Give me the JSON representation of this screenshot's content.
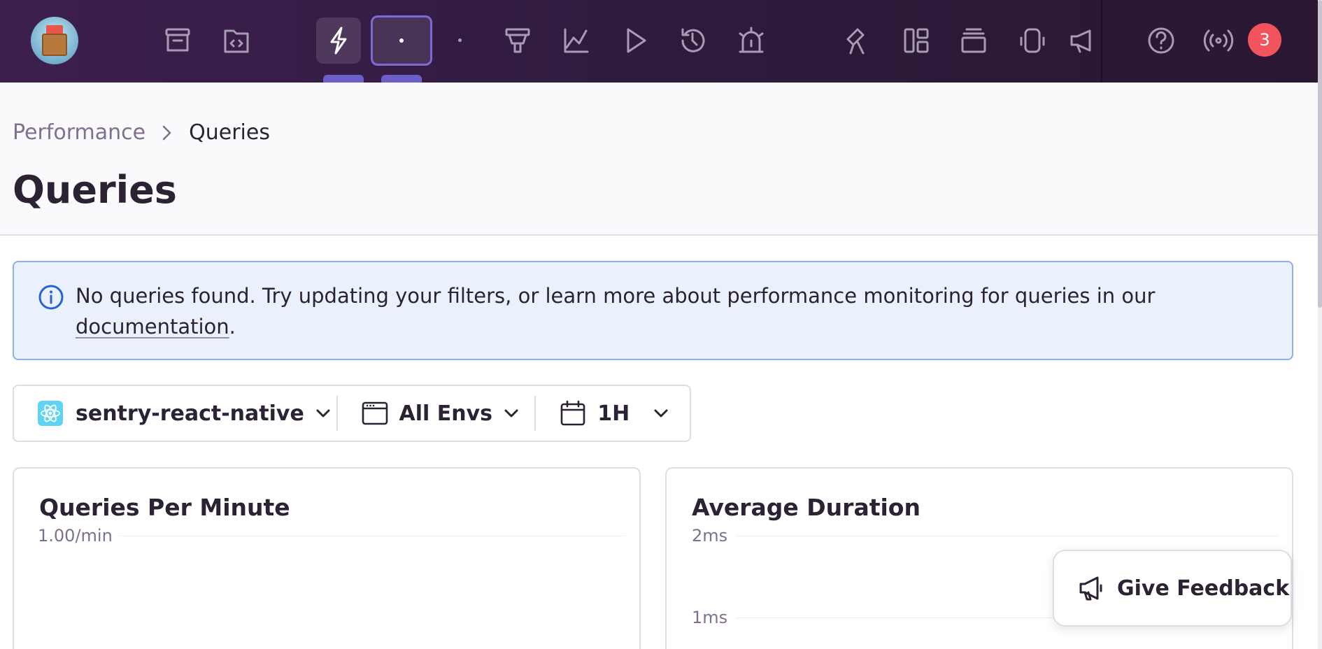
{
  "nav": {
    "notification_count": "3"
  },
  "breadcrumb": {
    "parent": "Performance",
    "current": "Queries"
  },
  "page": {
    "title": "Queries"
  },
  "alert": {
    "message": "No queries found. Try updating your filters, or learn more about performance monitoring for queries in our",
    "link_text": "documentation",
    "suffix": "."
  },
  "filters": {
    "project": "sentry-react-native",
    "environment": "All Envs",
    "period": "1H"
  },
  "panels": {
    "qpm": {
      "title": "Queries Per Minute",
      "y_top_label": "1.00/min"
    },
    "duration": {
      "title": "Average Duration",
      "y_top_label": "2ms",
      "y_mid_label": "1ms"
    }
  },
  "feedback": {
    "label": "Give Feedback"
  },
  "colors": {
    "nav_bg": "#3e1f4f",
    "accent": "#6c5fc7",
    "badge": "#f1545d",
    "alert_bg": "#eaf1fc",
    "alert_border": "#8fb0ea"
  },
  "icons": [
    "sentry-app-logo",
    "issues-icon",
    "projects-icon",
    "performance-icon",
    "dot-icon",
    "dot-icon",
    "releases-icon",
    "discover-icon",
    "replays-icon",
    "crons-icon",
    "alerts-icon",
    "stats-icon",
    "dashboards-icon",
    "feedback-icon",
    "settings-icon",
    "broadcasts-icon",
    "help-icon",
    "service-status-icon"
  ]
}
